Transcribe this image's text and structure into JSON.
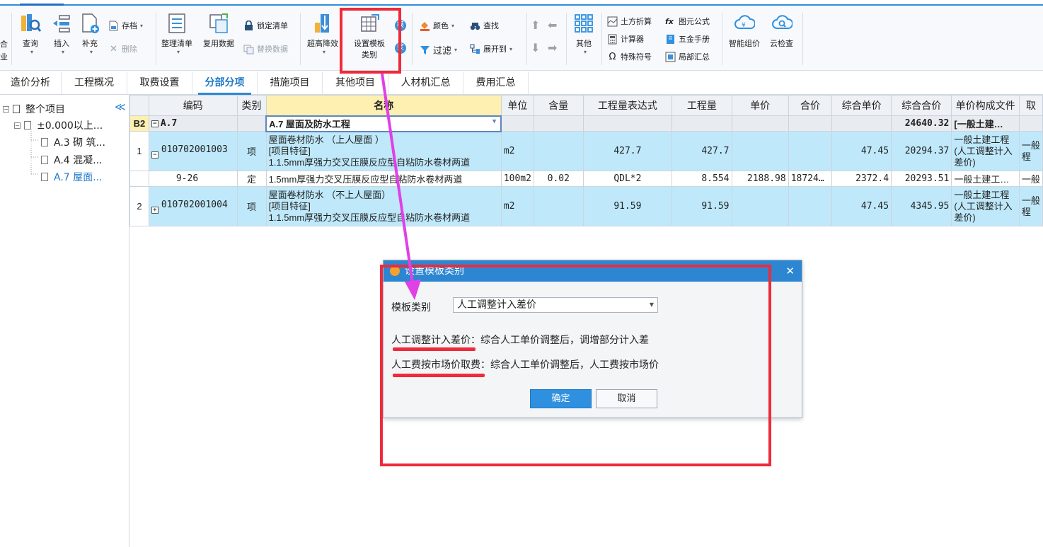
{
  "ribbon": {
    "cut_labels": [
      "合",
      "业"
    ],
    "query": "查询",
    "insert": "插入",
    "supplement": "补充",
    "archive": "存档",
    "delete": "删除",
    "organize_list": "整理清单",
    "reuse_data": "复用数据",
    "lock_list": "锁定清单",
    "replace_data": "替换数据",
    "super_high": "超高降效",
    "set_template_line1": "设置模板",
    "set_template_line2": "类别",
    "mo_glyph": "模",
    "jiang_glyph": "浆",
    "color": "颜色",
    "find": "查找",
    "filter": "过滤",
    "expand_to": "展开到",
    "other": "其他",
    "earthwork": "土方折算",
    "calculator": "计算器",
    "special_symbol": "特殊符号",
    "element_formula": "图元公式",
    "hardware_manual": "五金手册",
    "partial_summary": "局部汇总",
    "smart_pricing": "智能组价",
    "cloud_check": "云检查"
  },
  "tabs": [
    "造价分析",
    "工程概况",
    "取费设置",
    "分部分项",
    "措施项目",
    "其他项目",
    "人材机汇总",
    "费用汇总"
  ],
  "tree": {
    "root": "整个项目",
    "level1": "±0.000以上...",
    "children": [
      "A.3 砌 筑...",
      "A.4 混凝...",
      "A.7 屋面..."
    ]
  },
  "grid": {
    "headers": [
      "编码",
      "类别",
      "名称",
      "单位",
      "含量",
      "工程量表达式",
      "工程量",
      "单价",
      "合价",
      "综合单价",
      "综合合价",
      "单价构成文件",
      "取"
    ],
    "b2": {
      "idx": "B2",
      "code": "A.7",
      "name": "A.7   屋面及防水工程",
      "total": "24640.32",
      "file": "[一般土建…"
    },
    "row1": {
      "idx": "1",
      "code": "010702001003",
      "type": "项",
      "name1": "屋面卷材防水 （上人屋面 ）",
      "name2": "[项目特征]",
      "name3": "1.1.5mm厚强力交叉压膜反应型自粘防水卷材两道",
      "unit": "m2",
      "expr": "427.7",
      "qty": "427.7",
      "unit_price": "47.45",
      "total": "20294.37",
      "file": "一般土建工程(人工调整计入差价)",
      "extra": "一般程"
    },
    "sub1": {
      "code": "9-26",
      "type": "定",
      "name": "1.5mm厚强力交叉压膜反应型自粘防水卷材两道",
      "unit": "100m2",
      "content": "0.02",
      "expr": "QDL*2",
      "qty": "8.554",
      "price": "2188.98",
      "amount": "18724…",
      "unit_price": "2372.4",
      "total": "20293.51",
      "file": "一般土建工…",
      "extra": "一般"
    },
    "row2": {
      "idx": "2",
      "code": "010702001004",
      "type": "项",
      "name1": "屋面卷材防水 （不上人屋面）",
      "name2": "[项目特征]",
      "name3": "1.1.5mm厚强力交叉压膜反应型自粘防水卷材两道",
      "unit": "m2",
      "expr": "91.59",
      "qty": "91.59",
      "unit_price": "47.45",
      "total": "4345.95",
      "file": "一般土建工程(人工调整计入差价)",
      "extra": "一般程"
    }
  },
  "dialog": {
    "title": "设置模板类别",
    "label": "模板类别",
    "selected": "人工调整计入差价",
    "desc1": "人工调整计入差价：综合人工单价调整后，调增部分计入差",
    "desc2": "人工费按市场价取费：综合人工单价调整后，人工费按市场价",
    "ok": "确定",
    "cancel": "取消",
    "close": "✕"
  },
  "colors": {
    "accent": "#2c86d2",
    "selected_row": "#bfe9fb",
    "annotation_red": "#ee2b3a",
    "annotation_arrow": "#e040e6"
  }
}
